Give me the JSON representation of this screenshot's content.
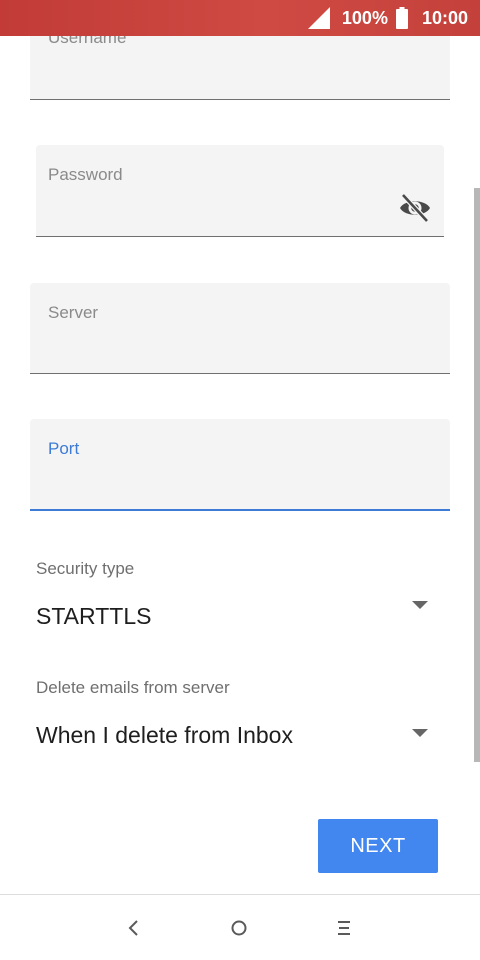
{
  "status_bar": {
    "battery": "100%",
    "time": "10:00",
    "background": "#c8423d"
  },
  "form": {
    "username": {
      "label": "Username",
      "value": ""
    },
    "password": {
      "label": "Password",
      "value": "",
      "toggle_icon": "eye-off-icon"
    },
    "server": {
      "label": "Server",
      "value": ""
    },
    "port": {
      "label": "Port",
      "value": "",
      "focused": true
    },
    "security_type": {
      "label": "Security type",
      "value": "STARTTLS"
    },
    "delete_emails": {
      "label": "Delete emails from server",
      "value": "When I delete from Inbox"
    },
    "next_label": "NEXT"
  },
  "colors": {
    "accent": "#3d7bd6",
    "button": "#4286f0",
    "field_bg": "#f4f4f4"
  },
  "nav_bar": {
    "icons": [
      "back-icon",
      "home-icon",
      "recents-icon"
    ]
  }
}
